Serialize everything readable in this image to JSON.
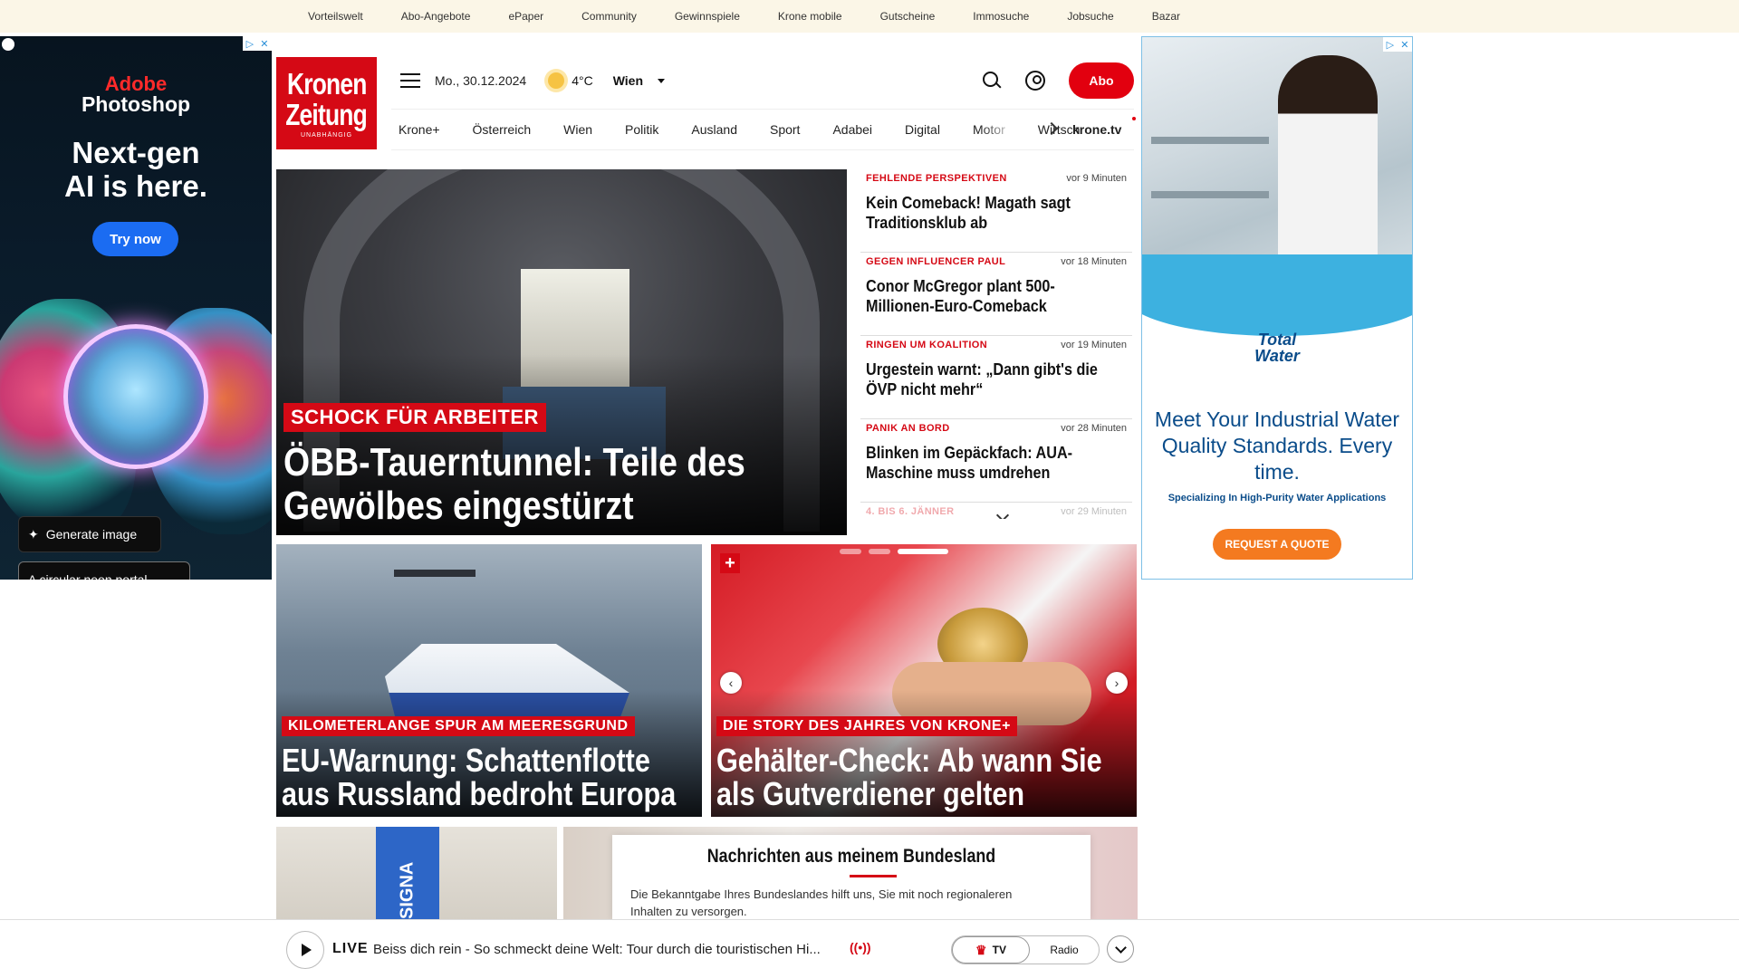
{
  "topbar": {
    "links": [
      "Vorteilswelt",
      "Abo-Angebote",
      "ePaper",
      "Community",
      "Gewinnspiele",
      "Krone mobile",
      "Gutscheine",
      "Immosuche",
      "Jobsuche",
      "Bazar"
    ]
  },
  "ad_left": {
    "brand_line1": "Adobe",
    "brand_line2": "Photoshop",
    "headline_line1": "Next-gen",
    "headline_line2": "AI is here.",
    "cta": "Try now",
    "generate_label": "Generate image",
    "prompt_text": "A circular neon portal ...",
    "icons": [
      "adchoices-icon",
      "close-icon",
      "privacy-icon",
      "sparkle-icon"
    ]
  },
  "ad_right": {
    "logo_line1": "Total",
    "logo_line2": "Water",
    "headline": "Meet Your Industrial Water Quality Standards. Every time.",
    "sub": "Specializing In High-Purity Water Applications",
    "cta": "REQUEST A QUOTE"
  },
  "header": {
    "logo_line1": "Kronen",
    "logo_line2": "Zeitung",
    "logo_tagline": "UNABHÄNGIG",
    "date": "Mo., 30.12.2024",
    "temperature": "4°C",
    "city": "Wien",
    "abo_label": "Abo",
    "nav": [
      "Krone+",
      "Österreich",
      "Wien",
      "Politik",
      "Ausland",
      "Sport",
      "Adabei",
      "Digital",
      "Motor",
      "Wirtsch"
    ],
    "tv_link": "krone.tv"
  },
  "hero": {
    "kicker": "SCHOCK FÜR ARBEITER",
    "title": "ÖBB-Tauerntunnel: Teile des Gewölbes eingestürzt"
  },
  "sidelist": [
    {
      "tag": "FEHLENDE PERSPEKTIVEN",
      "time": "vor 9 Minuten",
      "headline": "Kein Comeback! Magath sagt Traditionsklub ab"
    },
    {
      "tag": "GEGEN INFLUENCER PAUL",
      "time": "vor 18 Minuten",
      "headline": "Conor McGregor plant 500-Millionen-Euro-Comeback"
    },
    {
      "tag": "RINGEN UM KOALITION",
      "time": "vor 19 Minuten",
      "headline": "Urgestein warnt: „Dann gibt's die ÖVP nicht mehr“"
    },
    {
      "tag": "PANIK AN BORD",
      "time": "vor 28 Minuten",
      "headline": "Blinken im Gepäckfach: AUA-Maschine muss umdrehen"
    },
    {
      "tag": "4. BIS 6. JÄNNER",
      "time": "vor 29 Minuten",
      "headline": ""
    }
  ],
  "tiles": [
    {
      "kicker": "KILOMETERLANGE SPUR AM MEERESGRUND",
      "title": "EU-Warnung: Schattenflotte aus Russland bedroht Europa"
    },
    {
      "kicker": "DIE STORY DES JAHRES VON KRONE+",
      "title": "Gehälter-Check: Ab wann Sie als Gutverdiener gelten",
      "plus": "+"
    }
  ],
  "bottom": {
    "signa_text": "SIGNA",
    "bundesland_title": "Nachrichten aus meinem Bundesland",
    "bundesland_body": "Die Bekanntgabe Ihres Bundeslandes hilft uns, Sie mit noch regionaleren Inhalten zu versorgen."
  },
  "livebar": {
    "live_label": "LIVE",
    "live_text": "Beiss dich rein - So schmeckt deine Welt: Tour durch die touristischen Hi...",
    "radio_signal": "((•))",
    "tv_label": "TV",
    "radio_label": "Radio"
  }
}
